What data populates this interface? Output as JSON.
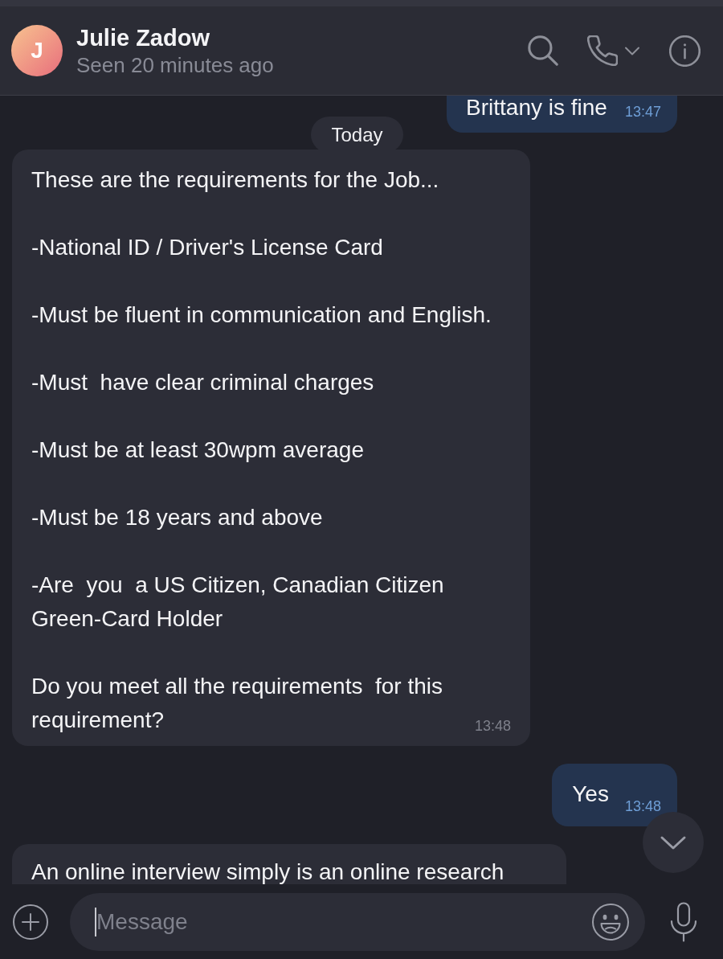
{
  "header": {
    "avatar_initial": "J",
    "name": "Julie Zadow",
    "status": "Seen 20 minutes ago"
  },
  "messages": [
    {
      "kind": "outgoing",
      "text": "Brittany is fine",
      "time": "13:47"
    },
    {
      "kind": "date",
      "text": "Today"
    },
    {
      "kind": "incoming",
      "paragraphs": [
        "These are the requirements for the Job...",
        "-National ID / Driver's License Card",
        "-Must be fluent in communication and English.",
        "-Must  have clear criminal charges",
        "-Must be at least 30wpm average",
        "-Must be 18 years and above",
        "-Are  you  a US Citizen, Canadian Citizen\nGreen-Card Holder",
        "Do you meet all the requirements  for this\nrequirement?"
      ],
      "time": "13:48"
    },
    {
      "kind": "outgoing",
      "text": "Yes",
      "time": "13:48"
    },
    {
      "kind": "incoming",
      "paragraphs": [
        "An online interview simply is an online research"
      ]
    }
  ],
  "composer": {
    "placeholder": "Message"
  }
}
